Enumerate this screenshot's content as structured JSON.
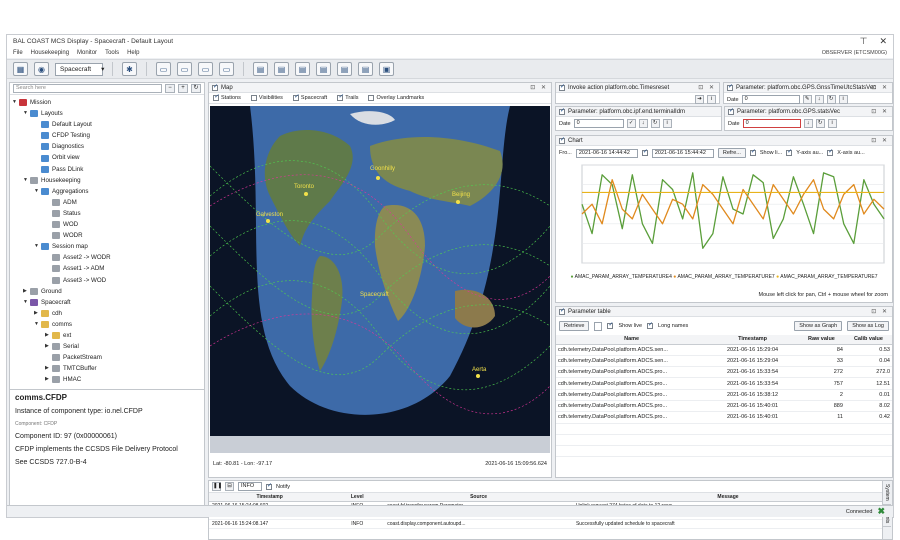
{
  "window": {
    "title": "BAL COAST MCS Display - Spacecraft - Default Layout",
    "user": "OBSERVER (ETCSM00G)"
  },
  "menu": [
    "File",
    "Housekeeping",
    "Monitor",
    "Tools",
    "Help"
  ],
  "toolbar": {
    "spacecraft_select": "Spacecraft"
  },
  "search": {
    "placeholder": "Search here"
  },
  "tree": [
    {
      "label": "Mission",
      "depth": 0,
      "icon": "red",
      "twisty": "▼"
    },
    {
      "label": "Layouts",
      "depth": 1,
      "icon": "blue",
      "twisty": "▼"
    },
    {
      "label": "Default Layout",
      "depth": 2,
      "icon": "blue",
      "twisty": ""
    },
    {
      "label": "CFDP Testing",
      "depth": 2,
      "icon": "blue",
      "twisty": ""
    },
    {
      "label": "Diagnostics",
      "depth": 2,
      "icon": "blue",
      "twisty": ""
    },
    {
      "label": "Orbit view",
      "depth": 2,
      "icon": "blue",
      "twisty": ""
    },
    {
      "label": "Pass DLink",
      "depth": 2,
      "icon": "blue",
      "twisty": ""
    },
    {
      "label": "Housekeeping",
      "depth": 1,
      "icon": "grey",
      "twisty": "▼"
    },
    {
      "label": "Aggregations",
      "depth": 2,
      "icon": "blue",
      "twisty": "▼"
    },
    {
      "label": "ADM",
      "depth": 3,
      "icon": "grey",
      "twisty": ""
    },
    {
      "label": "Status",
      "depth": 3,
      "icon": "grey",
      "twisty": ""
    },
    {
      "label": "WOD",
      "depth": 3,
      "icon": "grey",
      "twisty": ""
    },
    {
      "label": "WODR",
      "depth": 3,
      "icon": "grey",
      "twisty": ""
    },
    {
      "label": "Session map",
      "depth": 2,
      "icon": "blue",
      "twisty": "▼"
    },
    {
      "label": "Asset2 -> WODR",
      "depth": 3,
      "icon": "grey",
      "twisty": ""
    },
    {
      "label": "Asset1 -> ADM",
      "depth": 3,
      "icon": "grey",
      "twisty": ""
    },
    {
      "label": "Asset3 -> WOD",
      "depth": 3,
      "icon": "grey",
      "twisty": ""
    },
    {
      "label": "Ground",
      "depth": 1,
      "icon": "grey",
      "twisty": "▶"
    },
    {
      "label": "Spacecraft",
      "depth": 1,
      "icon": "purple",
      "twisty": "▼"
    },
    {
      "label": "cdh",
      "depth": 2,
      "icon": "folder",
      "twisty": "▶"
    },
    {
      "label": "comms",
      "depth": 2,
      "icon": "folder",
      "twisty": "▼"
    },
    {
      "label": "ext",
      "depth": 3,
      "icon": "folder",
      "twisty": "▶"
    },
    {
      "label": "Serial",
      "depth": 3,
      "icon": "grey",
      "twisty": "▶"
    },
    {
      "label": "PacketStream",
      "depth": 3,
      "icon": "grey",
      "twisty": ""
    },
    {
      "label": "TMTCBuffer",
      "depth": 3,
      "icon": "grey",
      "twisty": "▶"
    },
    {
      "label": "HMAC",
      "depth": 3,
      "icon": "grey",
      "twisty": "▶"
    }
  ],
  "detail": {
    "heading": "comms.CFDP",
    "line1": "Instance of component type: io.nel.CFDP",
    "small": "Component: CFDP",
    "line2": "Component ID: 97 (0x00000061)",
    "line3": "CFDP implements the CCSDS File Delivery Protocol",
    "line4": "See CCSDS 727.0-B-4"
  },
  "map": {
    "title": "Map",
    "options": [
      "Stations",
      "Visibilities",
      "Spacecraft",
      "Trails",
      "Overlay Landmarks"
    ],
    "status_left": "Lat: -80.81 - Lon: -97.17",
    "status_right": "2021-06-16 15:09:56.624",
    "places": [
      "Toronto",
      "Goonhilly",
      "Galveston",
      "Beijing",
      "Spacecraft",
      "Aerta"
    ]
  },
  "invoke": {
    "title": "Invoke action platform.obc.Timesreset"
  },
  "param1": {
    "title": "Parameter: platform.obc.GPS.GnssTimeUtcStatsVec",
    "label": "Date",
    "value": "0"
  },
  "param2": {
    "title": "Parameter: platform.obc.ipf.end.terminalIdm",
    "label": "Date",
    "value": "0"
  },
  "param3": {
    "title": "Parameter: platform.obc.GPS.statsVec",
    "label": "Date",
    "value": "0"
  },
  "chart": {
    "title": "Chart",
    "from": "2021-06-16 14:44:42",
    "to": "2021-06-16 15:44:42",
    "refresh": "Refre...",
    "show_label": "Show li...",
    "y_left": "Y-axis au...",
    "x_label": "X-axis au...",
    "hint": "Mouse left click for pan, Ctrl + mouse wheel for zoom",
    "legend": [
      "AMAC_PARAM_ARRAY_TEMPERATURE4",
      "AMAC_PARAM_ARRAY_TEMPERATURE7",
      "AMAC_PARAM_ARRAY_TEMPERATURE7"
    ]
  },
  "chart_data": {
    "type": "line",
    "x": [
      0,
      1,
      2,
      3,
      4,
      5,
      6,
      7,
      8,
      9,
      10,
      11,
      12,
      13,
      14,
      15,
      16,
      17,
      18,
      19,
      20,
      21,
      22,
      23,
      24,
      25,
      26,
      27,
      28,
      29,
      30
    ],
    "series": [
      {
        "name": "AMAC_PARAM_ARRAY_TEMPERATURE4",
        "color": "#5a9e3a",
        "values": [
          60,
          30,
          90,
          80,
          35,
          90,
          40,
          20,
          85,
          75,
          45,
          92,
          15,
          30,
          88,
          55,
          50,
          90,
          82,
          25,
          45,
          88,
          60,
          30,
          92,
          88,
          40,
          20,
          85,
          60,
          45
        ]
      },
      {
        "name": "AMAC_PARAM_ARRAY_TEMPERATURE7",
        "color": "#e08a1e",
        "values": [
          50,
          60,
          40,
          85,
          55,
          45,
          70,
          55,
          40,
          65,
          60,
          45,
          80,
          70,
          55,
          40,
          75,
          60,
          45,
          80,
          65,
          50,
          70,
          85,
          55,
          45,
          70,
          80,
          50,
          65,
          55
        ]
      },
      {
        "name": "AMAC_PARAM_ARRAY_TEMPERATURE7",
        "color": "#e8b31c",
        "values": [
          72,
          72,
          72,
          72,
          72,
          72,
          72,
          72,
          72,
          72,
          72,
          72,
          72,
          72,
          72,
          72,
          72,
          72,
          72,
          72,
          72,
          72,
          72,
          72,
          72,
          72,
          72,
          72,
          72,
          72,
          72
        ]
      }
    ]
  },
  "param_table": {
    "title": "Parameter table",
    "retrieve": "Retrieve",
    "show_live": "Show live",
    "long_names": "Long names",
    "show_graph": "Show as Graph",
    "show_log": "Show as Log",
    "columns": [
      "Name",
      "Timestamp",
      "Raw value",
      "Calib value"
    ],
    "rows": [
      [
        "cdh.telemetry.DataPool.platform.ADCS.sen...",
        "2021-06-16 15:29:04",
        "84",
        "0.53"
      ],
      [
        "cdh.telemetry.DataPool.platform.ADCS.sen...",
        "2021-06-16 15:29:04",
        "33",
        "0.04"
      ],
      [
        "cdh.telemetry.DataPool.platform.ADCS.pro...",
        "2021-06-16 15:33:54",
        "272",
        "272.0"
      ],
      [
        "cdh.telemetry.DataPool.platform.ADCS.pro...",
        "2021-06-16 15:33:54",
        "757",
        "12.51"
      ],
      [
        "cdh.telemetry.DataPool.platform.ADCS.pro...",
        "2021-06-16 15:38:12",
        "2",
        "0.01"
      ],
      [
        "cdh.telemetry.DataPool.platform.ADCS.pro...",
        "2021-06-16 15:40:01",
        "889",
        "8.02"
      ],
      [
        "cdh.telemetry.DataPool.platform.ADCS.pro...",
        "2021-06-16 15:40:01",
        "11",
        "0.42"
      ]
    ]
  },
  "log": {
    "level": "INFO",
    "notify": "Notify",
    "columns": [
      "Timestamp",
      "Level",
      "Source",
      "Message"
    ],
    "rows": [
      [
        "2021-06-16 15:24:08.602",
        "INFO",
        "coast.fd.transfer.param.Parameter...",
        "Uplink request 274 bytes of data to 12 rows"
      ],
      [
        "2021-06-16 15:24:08.617",
        "INFO",
        "coast.fd.transfer.param.Addressed...",
        "2 sets of 9 rows"
      ],
      [
        "2021-06-16 15:24:08.147",
        "INFO",
        "coast.display.component.autoupd...",
        "Successfully updated schedule to spacecraft"
      ]
    ]
  },
  "side_tabs": [
    "System",
    "Events"
  ],
  "status": {
    "text": "Connected"
  }
}
